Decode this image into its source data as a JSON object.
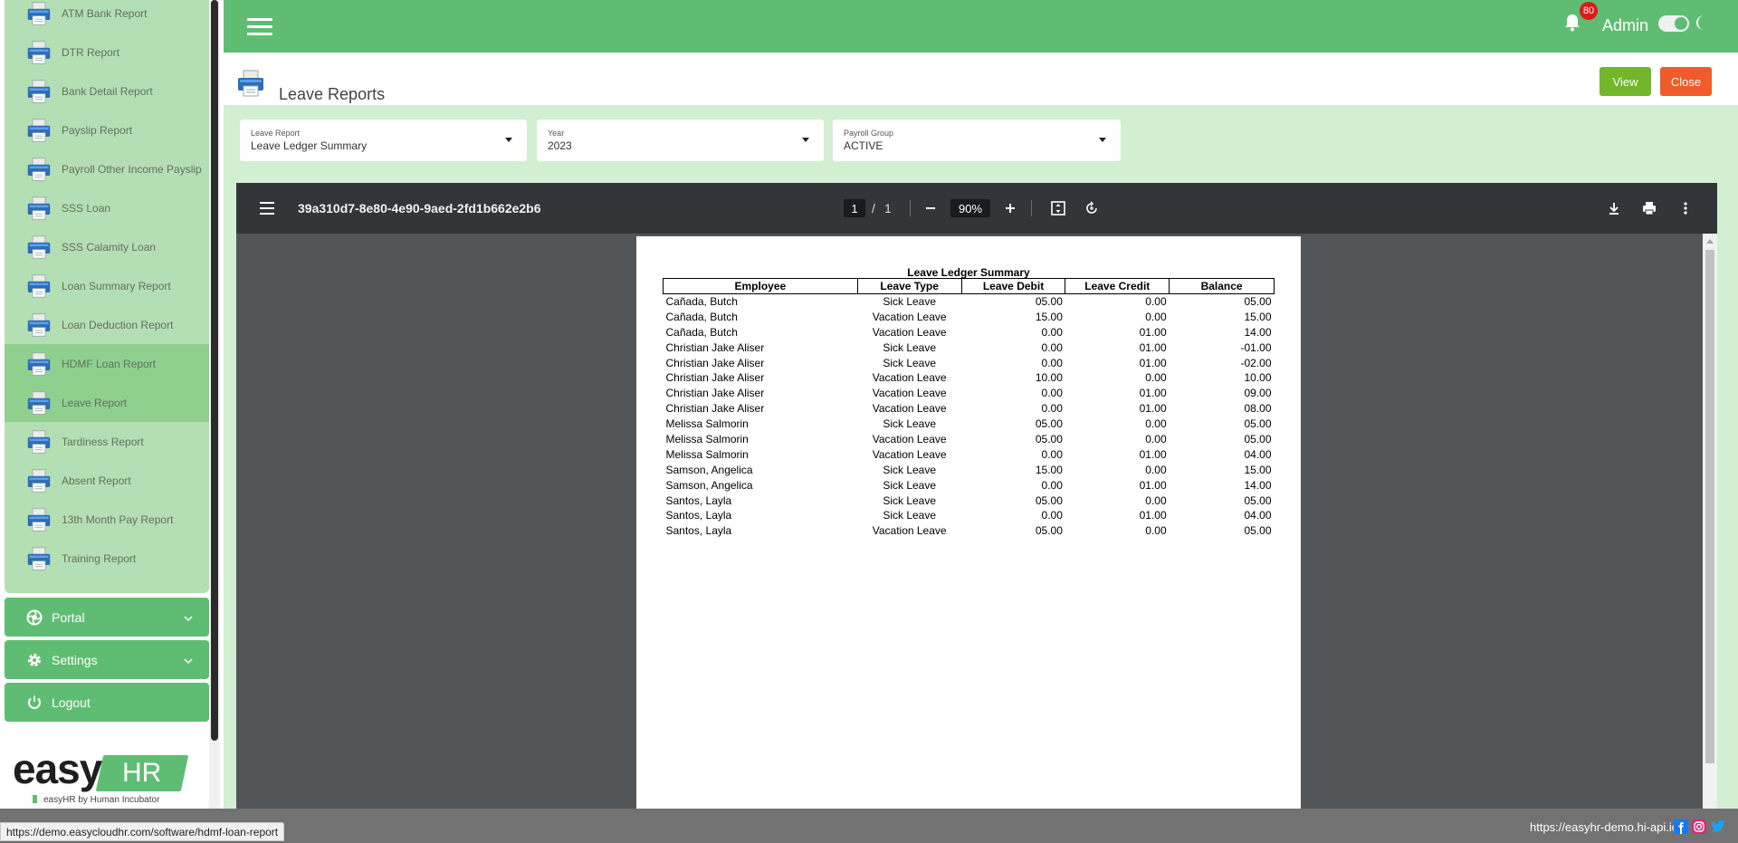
{
  "sidebar": {
    "reports": [
      {
        "label": "ATM Bank Report",
        "active": false
      },
      {
        "label": "DTR Report",
        "active": false
      },
      {
        "label": "Bank Detail Report",
        "active": false
      },
      {
        "label": "Payslip Report",
        "active": false
      },
      {
        "label": "Payroll Other Income Payslip",
        "active": false
      },
      {
        "label": "SSS Loan",
        "active": false
      },
      {
        "label": "SSS Calamity Loan",
        "active": false
      },
      {
        "label": "Loan Summary Report",
        "active": false
      },
      {
        "label": "Loan Deduction Report",
        "active": false
      },
      {
        "label": "HDMF Loan Report",
        "active": true
      },
      {
        "label": "Leave Report",
        "active": true
      },
      {
        "label": "Tardiness Report",
        "active": false
      },
      {
        "label": "Absent Report",
        "active": false
      },
      {
        "label": "13th Month Pay Report",
        "active": false
      },
      {
        "label": "Training Report",
        "active": false
      }
    ],
    "portal_label": "Portal",
    "settings_label": "Settings",
    "logout_label": "Logout",
    "logo_text": "easy",
    "logo_hr": "HR",
    "logo_sub": "easyHR by Human Incubator"
  },
  "header": {
    "notification_count": "80",
    "user_label": "Admin",
    "theme_toggle_on": true
  },
  "page": {
    "title": "Leave Reports",
    "view_label": "View",
    "close_label": "Close"
  },
  "filters": {
    "leave_report": {
      "caption": "Leave Report",
      "value": "Leave Ledger Summary"
    },
    "year": {
      "caption": "Year",
      "value": "2023"
    },
    "payroll_group": {
      "caption": "Payroll Group",
      "value": "ACTIVE"
    }
  },
  "pdf_viewer": {
    "filename": "39a310d7-8e80-4e90-9aed-2fd1b662e2b6",
    "current_page": "1",
    "page_separator": "/",
    "total_pages": "1",
    "zoom": "90%"
  },
  "report": {
    "title": "Leave Ledger Summary",
    "columns": [
      "Employee",
      "Leave Type",
      "Leave Debit",
      "Leave Credit",
      "Balance"
    ],
    "rows": [
      [
        "Cañada, Butch",
        "Sick Leave",
        "05.00",
        "0.00",
        "05.00"
      ],
      [
        "Cañada, Butch",
        "Vacation Leave",
        "15.00",
        "0.00",
        "15.00"
      ],
      [
        "Cañada, Butch",
        "Vacation Leave",
        "0.00",
        "01.00",
        "14.00"
      ],
      [
        "Christian Jake  Aliser",
        "Sick Leave",
        "0.00",
        "01.00",
        "-01.00"
      ],
      [
        "Christian Jake  Aliser",
        "Sick Leave",
        "0.00",
        "01.00",
        "-02.00"
      ],
      [
        "Christian Jake  Aliser",
        "Vacation Leave",
        "10.00",
        "0.00",
        "10.00"
      ],
      [
        "Christian Jake  Aliser",
        "Vacation Leave",
        "0.00",
        "01.00",
        "09.00"
      ],
      [
        "Christian Jake  Aliser",
        "Vacation Leave",
        "0.00",
        "01.00",
        "08.00"
      ],
      [
        "Melissa  Salmorin",
        "Sick Leave",
        "05.00",
        "0.00",
        "05.00"
      ],
      [
        "Melissa  Salmorin",
        "Vacation Leave",
        "05.00",
        "0.00",
        "05.00"
      ],
      [
        "Melissa  Salmorin",
        "Vacation Leave",
        "0.00",
        "01.00",
        "04.00"
      ],
      [
        "Samson, Angelica",
        "Sick Leave",
        "15.00",
        "0.00",
        "15.00"
      ],
      [
        "Samson, Angelica",
        "Sick Leave",
        "0.00",
        "01.00",
        "14.00"
      ],
      [
        "Santos, Layla",
        "Sick Leave",
        "05.00",
        "0.00",
        "05.00"
      ],
      [
        "Santos, Layla",
        "Sick Leave",
        "0.00",
        "01.00",
        "04.00"
      ],
      [
        "Santos, Layla",
        "Vacation Leave",
        "05.00",
        "0.00",
        "05.00"
      ]
    ]
  },
  "footer": {
    "status_url": "https://demo.easycloudhr.com/software/hdmf-loan-report",
    "site_url": "https://easyhr-demo.hi-api.io"
  },
  "colors": {
    "brand_green": "#5fbd73",
    "sidebar_bg": "#b4dfb4",
    "sidebar_active": "#8fd08f",
    "view_button": "#72b62a",
    "close_button": "#ef5b2a",
    "pdf_toolbar": "#323639"
  }
}
